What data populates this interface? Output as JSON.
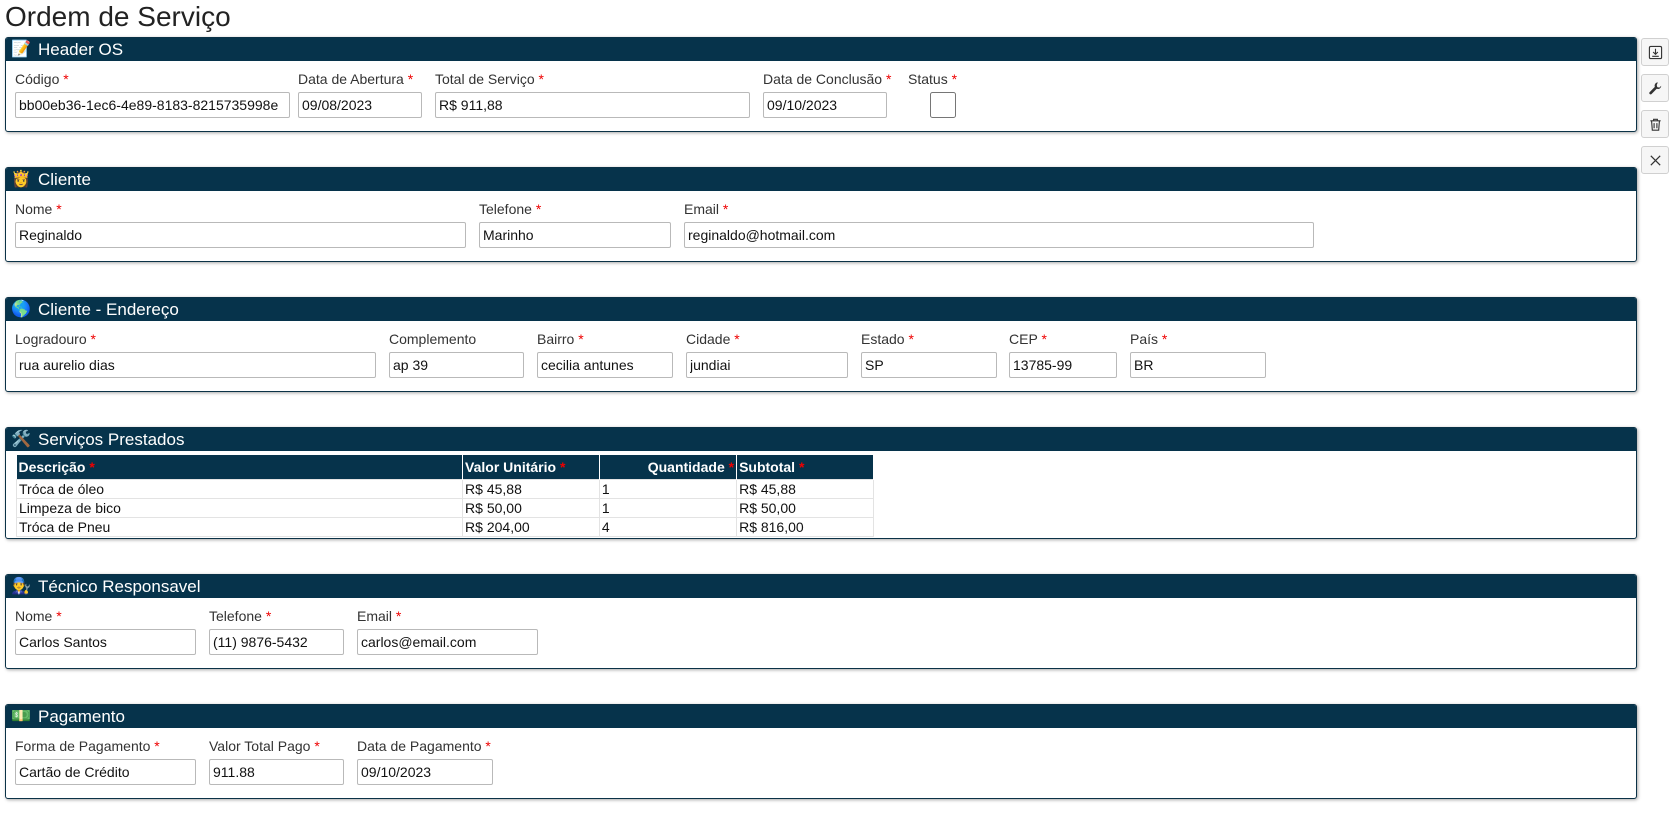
{
  "page_title": "Ordem de Serviço",
  "header_os": {
    "title": "Header OS",
    "emoji": "📝",
    "codigo": {
      "label": "Código",
      "value": "bb00eb36-1ec6-4e89-8183-8215735998e"
    },
    "data_abertura": {
      "label": "Data de Abertura",
      "value": "09/08/2023"
    },
    "total_servico": {
      "label": "Total de Serviço",
      "value": "R$ 911,88"
    },
    "data_conclusao": {
      "label": "Data de Conclusão",
      "value": "09/10/2023"
    },
    "status": {
      "label": "Status",
      "checked": false
    }
  },
  "cliente": {
    "title": "Cliente",
    "emoji": "👸",
    "nome": {
      "label": "Nome",
      "value": "Reginaldo"
    },
    "telefone": {
      "label": "Telefone",
      "value": "Marinho"
    },
    "email": {
      "label": "Email",
      "value": "reginaldo@hotmail.com"
    }
  },
  "endereco": {
    "title": "Cliente - Endereço",
    "emoji": "🌎",
    "logradouro": {
      "label": "Logradouro",
      "value": "rua aurelio dias"
    },
    "complemento": {
      "label": "Complemento",
      "value": "ap 39"
    },
    "bairro": {
      "label": "Bairro",
      "value": "cecilia antunes"
    },
    "cidade": {
      "label": "Cidade",
      "value": "jundiai"
    },
    "estado": {
      "label": "Estado",
      "value": "SP"
    },
    "cep": {
      "label": "CEP",
      "value": "13785-99"
    },
    "pais": {
      "label": "País",
      "value": "BR"
    }
  },
  "servicos": {
    "title": "Serviços Prestados",
    "emoji": "🛠️",
    "columns": [
      "Descrição",
      "Valor Unitário",
      "Quantidade",
      "Subtotal"
    ],
    "rows": [
      [
        "Tróca de óleo",
        "R$ 45,88",
        "1",
        "R$ 45,88"
      ],
      [
        "Limpeza de bico",
        "R$ 50,00",
        "1",
        "R$ 50,00"
      ],
      [
        "Tróca de Pneu",
        "R$ 204,00",
        "4",
        "R$ 816,00"
      ]
    ]
  },
  "tecnico": {
    "title": "Técnico Responsavel",
    "emoji": "👨‍🔧",
    "nome": {
      "label": "Nome",
      "value": "Carlos Santos"
    },
    "telefone": {
      "label": "Telefone",
      "value": "(11) 9876-5432"
    },
    "email": {
      "label": "Email",
      "value": "carlos@email.com"
    }
  },
  "pagamento": {
    "title": "Pagamento",
    "emoji": "💵",
    "forma": {
      "label": "Forma de Pagamento",
      "value": "Cartão de Crédito"
    },
    "valor_pago": {
      "label": "Valor Total Pago",
      "value": "911.88"
    },
    "data": {
      "label": "Data de Pagamento",
      "value": "09/10/2023"
    }
  },
  "required_mark": "*",
  "toolbar": {
    "icons": [
      "save-icon",
      "wrench-icon",
      "trash-icon",
      "close-icon"
    ]
  }
}
